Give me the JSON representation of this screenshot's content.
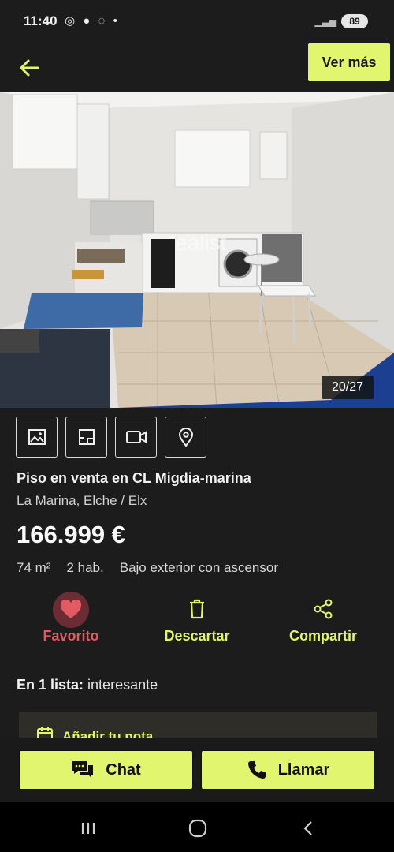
{
  "status": {
    "time": "11:40",
    "battery": "89",
    "icons": [
      "alarm-icon",
      "chat-bubble-icon",
      "whatsapp-icon",
      "dot-icon"
    ]
  },
  "header": {
    "back_icon": "arrow-left-icon",
    "ver_mas_label": "Ver más"
  },
  "photo": {
    "counter": "20/27",
    "watermark": "ealist"
  },
  "media_tabs": [
    "photos-icon",
    "floorplan-icon",
    "video-icon",
    "map-pin-icon"
  ],
  "listing": {
    "title": "Piso en venta en CL Migdia-marina",
    "location": "La Marina, Elche / Elx",
    "price": "166.999 €",
    "features": [
      "74 m²",
      "2 hab.",
      "Bajo exterior con ascensor"
    ]
  },
  "actions": {
    "favorite": "Favorito",
    "discard": "Descartar",
    "share": "Compartir"
  },
  "list_info": {
    "prefix": "En 1 lista:",
    "value": "interesante"
  },
  "note": {
    "label": "Añadir tu nota"
  },
  "bottom": {
    "chat": "Chat",
    "call": "Llamar"
  },
  "colors": {
    "accent": "#e1f56f",
    "favorite": "#e25b63",
    "background": "#1c1c1c"
  }
}
